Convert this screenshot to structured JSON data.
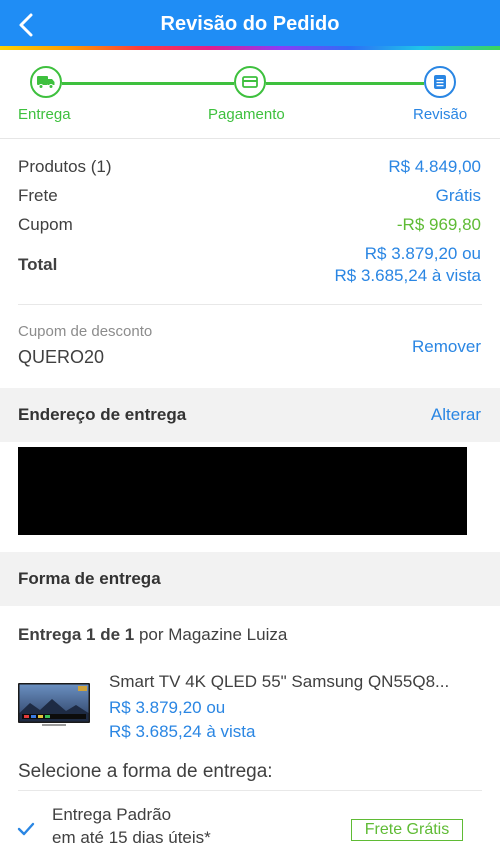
{
  "header": {
    "title": "Revisão do Pedido",
    "back_icon": "chevron-left-icon",
    "bg_color": "#1f8df5"
  },
  "steps": [
    {
      "label": "Entrega",
      "icon": "truck-icon",
      "state": "done"
    },
    {
      "label": "Pagamento",
      "icon": "card-icon",
      "state": "done"
    },
    {
      "label": "Revisão",
      "icon": "document-icon",
      "state": "current"
    }
  ],
  "summary": {
    "products_label": "Produtos (1)",
    "products_value": "R$ 4.849,00",
    "shipping_label": "Frete",
    "shipping_value": "Grátis",
    "coupon_label": "Cupom",
    "coupon_value": "-R$ 969,80",
    "total_label": "Total",
    "total_value_line1": "R$ 3.879,20 ou",
    "total_value_line2": "R$ 3.685,24 à vista"
  },
  "coupon": {
    "label": "Cupom de desconto",
    "code": "QUERO20",
    "remove_label": "Remover"
  },
  "address": {
    "title": "Endereço de entrega",
    "change_label": "Alterar"
  },
  "delivery": {
    "title": "Forma de entrega",
    "package_label_bold": "Entrega 1 de 1",
    "package_label_rest": " por Magazine Luiza",
    "product_name": "Smart TV 4K QLED 55\" Samsung QN55Q8...",
    "product_price_line1": "R$ 3.879,20 ou",
    "product_price_line2": "R$ 3.685,24 à vista",
    "select_title": "Selecione a forma de entrega:",
    "option_name": "Entrega Padrão",
    "option_eta": "em até 15 dias úteis*",
    "option_badge": "Frete Grátis"
  },
  "colors": {
    "blue": "#2a86e3",
    "green": "#5fbb35",
    "step_green": "#3ec03e"
  }
}
